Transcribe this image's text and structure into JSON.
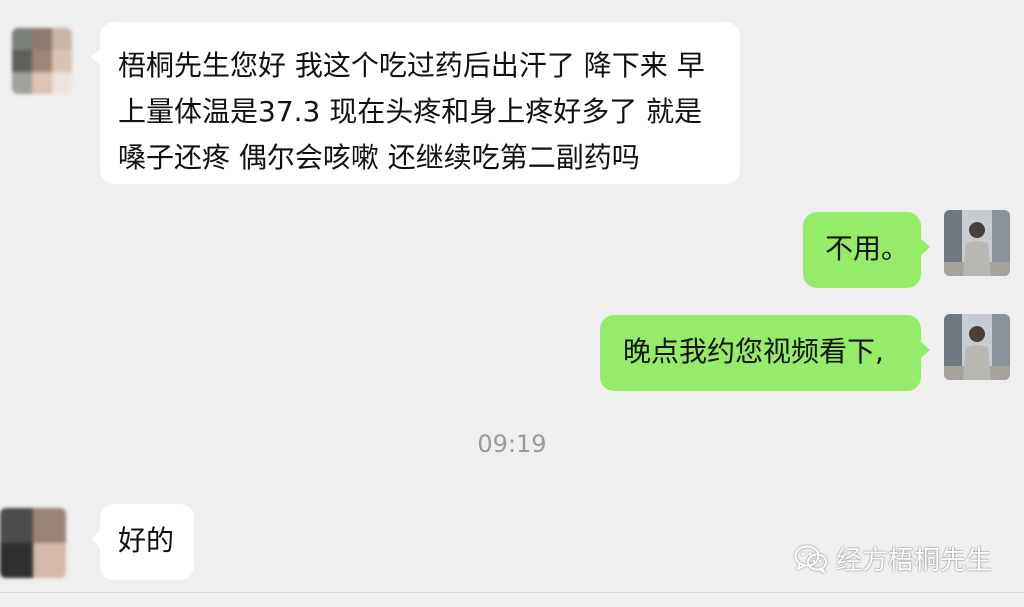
{
  "messages": [
    {
      "direction": "incoming",
      "text": "梧桐先生您好 我这个吃过药后出汗了 降下来 早上量体温是37.3 现在头疼和身上疼好多了 就是嗓子还疼 偶尔会咳嗽 还继续吃第二副药吗"
    },
    {
      "direction": "outgoing",
      "text": "不用。"
    },
    {
      "direction": "outgoing",
      "text": "晚点我约您视频看下,"
    },
    {
      "direction": "timestamp",
      "text": "09:19"
    },
    {
      "direction": "incoming",
      "text": "好的"
    }
  ],
  "watermark": {
    "text": "经方梧桐先生",
    "icon": "wechat-icon"
  },
  "colors": {
    "background": "#efefef",
    "incoming_bubble": "#ffffff",
    "outgoing_bubble": "#95ec69",
    "timestamp": "#9b9b9b"
  }
}
